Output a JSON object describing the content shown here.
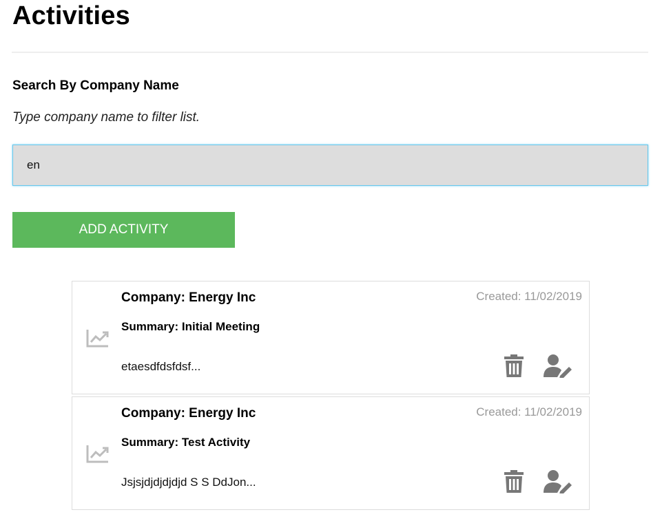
{
  "page": {
    "title": "Activities"
  },
  "search": {
    "label": "Search By Company Name",
    "hint": "Type company name to filter list.",
    "value": "en"
  },
  "actions": {
    "add_label": "ADD ACTIVITY"
  },
  "colors": {
    "add_button": "#5cb85c",
    "input_bg": "#dddddd",
    "input_focus_border": "#66c7ec",
    "icon_gray": "#777777",
    "meta_text": "#999999"
  },
  "activities": [
    {
      "company": "Company: Energy Inc",
      "created": "Created: 11/02/2019",
      "summary": "Summary: Initial Meeting",
      "description": "etaesdfdsfdsf...",
      "icon": "chart-line-icon"
    },
    {
      "company": "Company: Energy Inc",
      "created": "Created: 11/02/2019",
      "summary": "Summary: Test Activity",
      "description": "Jsjsjdjdjdjdjd S S DdJon...",
      "icon": "chart-line-icon"
    }
  ]
}
